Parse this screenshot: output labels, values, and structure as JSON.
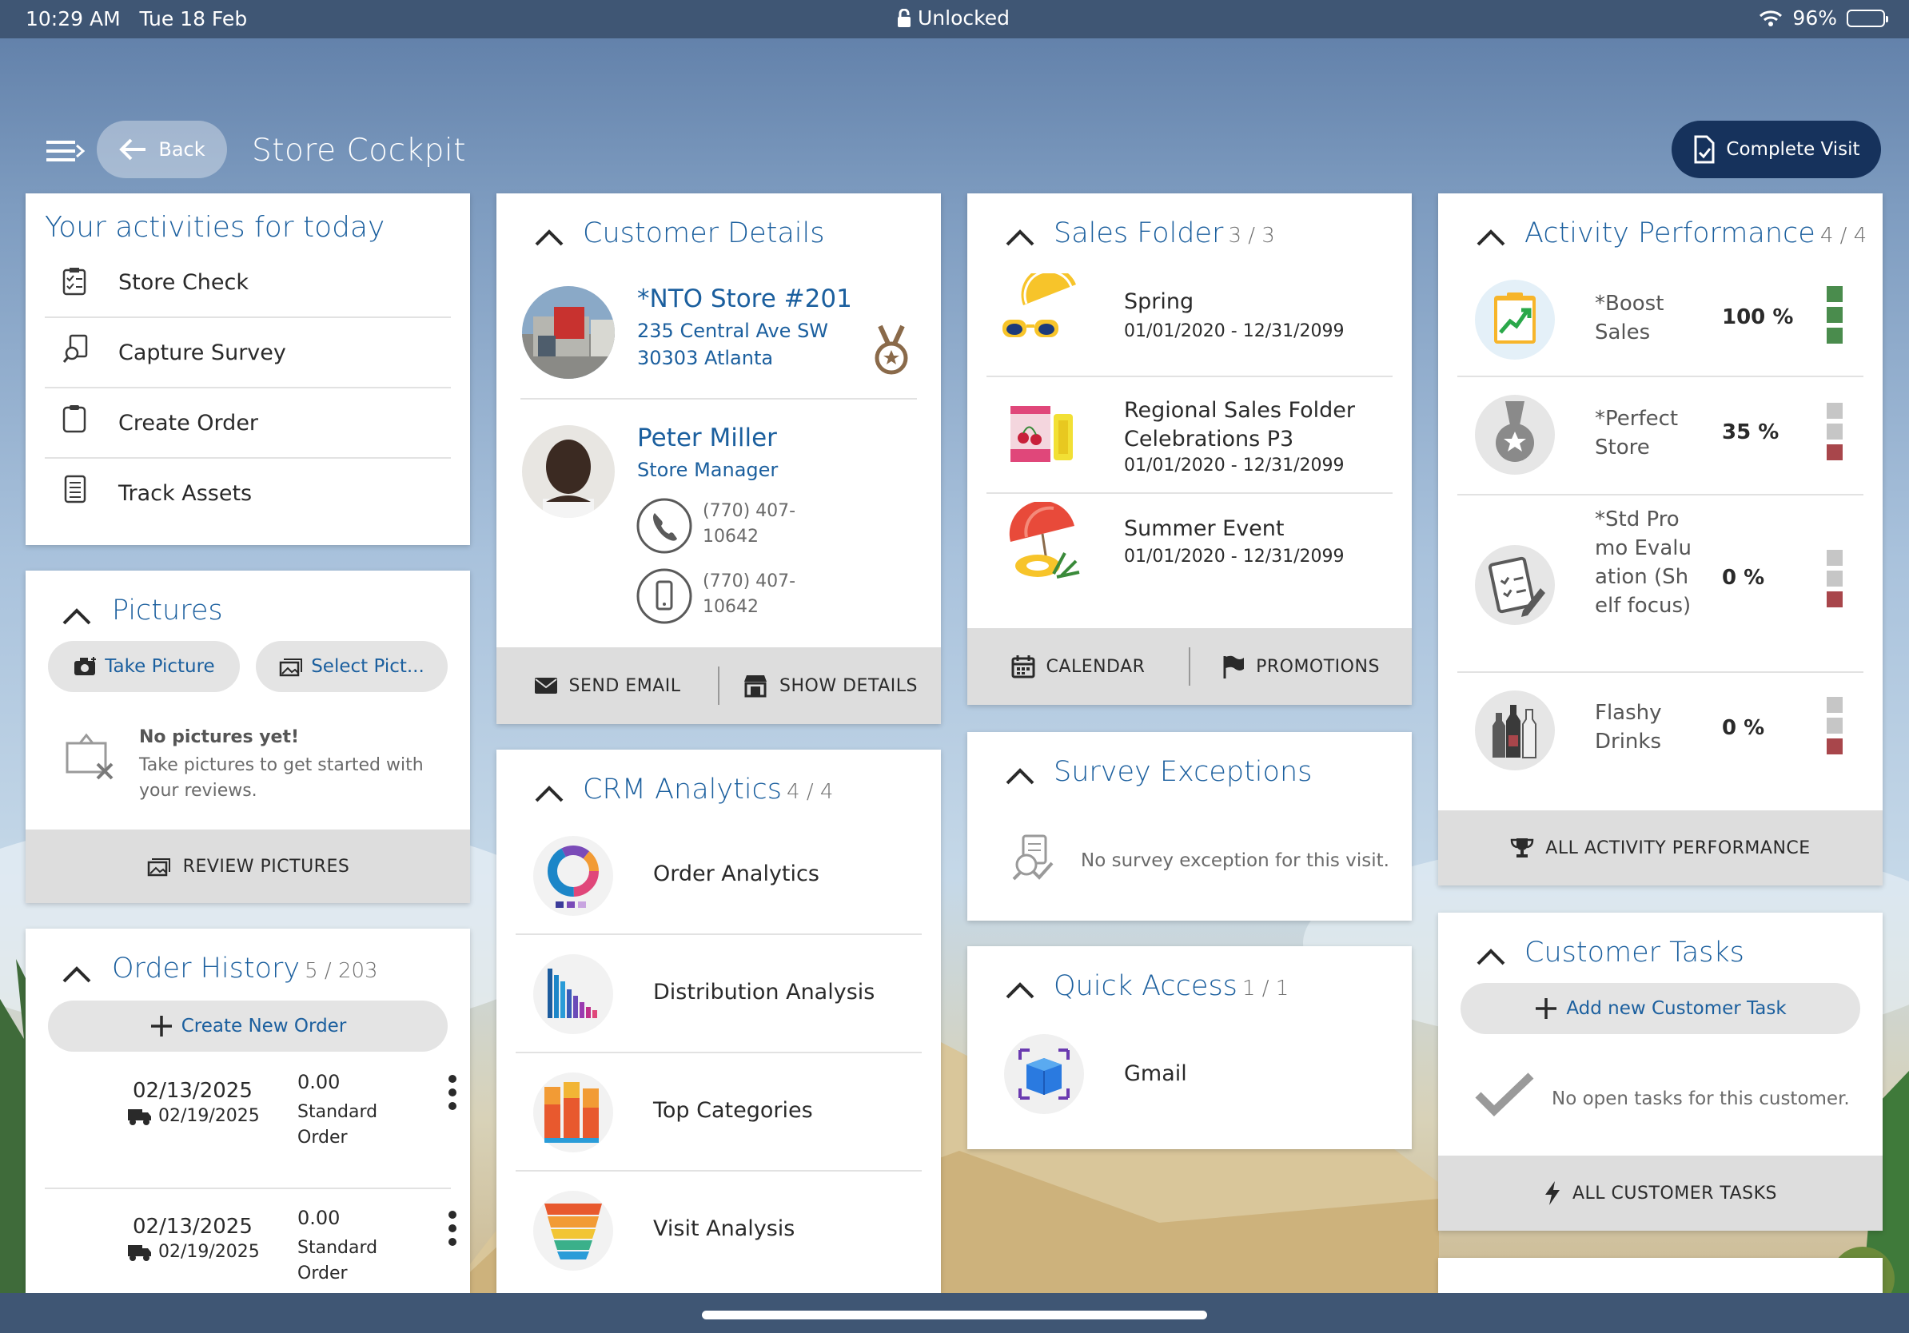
{
  "status_bar": {
    "time": "10:29 AM",
    "date": "Tue 18 Feb",
    "lock": "Unlocked",
    "battery": "96%"
  },
  "header": {
    "back_label": "Back",
    "title": "Store Cockpit",
    "complete_visit_label": "Complete Visit"
  },
  "activities": {
    "title": "Your activities for today",
    "items": [
      {
        "label": "Store Check",
        "icon": "checklist-icon"
      },
      {
        "label": "Capture Survey",
        "icon": "survey-search-icon"
      },
      {
        "label": "Create Order",
        "icon": "clipboard-icon"
      },
      {
        "label": "Track Assets",
        "icon": "asset-list-icon"
      }
    ]
  },
  "pictures": {
    "title": "Pictures",
    "take_label": "Take Picture",
    "select_label": "Select Pict...",
    "empty_title": "No pictures yet!",
    "empty_text": "Take pictures to get started with your reviews.",
    "review_label": "REVIEW PICTURES"
  },
  "order_history": {
    "title": "Order History",
    "count": "5 / 203",
    "create_label": "Create New Order",
    "orders": [
      {
        "order_date": "02/13/2025",
        "delivery_date": "02/19/2025",
        "amount": "0.00",
        "type": "Standard Order"
      },
      {
        "order_date": "02/13/2025",
        "delivery_date": "02/19/2025",
        "amount": "0.00",
        "type": "Standard Order"
      }
    ]
  },
  "customer_details": {
    "title": "Customer Details",
    "store_name": "*NTO Store #201",
    "address1": "235 Central Ave SW",
    "address2": "30303 Atlanta",
    "contact_name": "Peter Miller",
    "contact_role": "Store Manager",
    "phone": "(770) 407-10642",
    "mobile": "(770) 407-10642",
    "send_email_label": "SEND EMAIL",
    "show_details_label": "SHOW DETAILS"
  },
  "crm_analytics": {
    "title": "CRM Analytics",
    "count": "4 / 4",
    "items": [
      {
        "label": "Order Analytics",
        "icon": "donut-chart-icon"
      },
      {
        "label": "Distribution Analysis",
        "icon": "bar-chart-icon"
      },
      {
        "label": "Top Categories",
        "icon": "stacked-bar-icon"
      },
      {
        "label": "Visit Analysis",
        "icon": "funnel-chart-icon"
      }
    ]
  },
  "sales_folder": {
    "title": "Sales Folder",
    "count": "3 / 3",
    "items": [
      {
        "name": "Spring",
        "dates": "01/01/2020 - 12/31/2099",
        "icon": "sunglasses-lemon-icon"
      },
      {
        "name": "Regional Sales Folder Celebrations P3",
        "dates": "01/01/2020 - 12/31/2099",
        "icon": "cherry-drinks-icon"
      },
      {
        "name": "Summer Event",
        "dates": "01/01/2020 - 12/31/2099",
        "icon": "beach-umbrella-icon"
      }
    ],
    "calendar_label": "CALENDAR",
    "promotions_label": "PROMOTIONS"
  },
  "survey_exceptions": {
    "title": "Survey Exceptions",
    "empty_text": "No survey exception for this visit."
  },
  "quick_access": {
    "title": "Quick Access",
    "count": "1 / 1",
    "items": [
      {
        "label": "Gmail",
        "icon": "gmail-box-icon"
      }
    ]
  },
  "activity_performance": {
    "title": "Activity Performance",
    "count": "4 / 4",
    "items": [
      {
        "name": "*Boost Sales",
        "percent": "100 %",
        "icon": "growth-chart-icon",
        "levels": [
          "#4a8c4d",
          "#4a8c4d",
          "#4a8c4d"
        ]
      },
      {
        "name": "*Perfect Store",
        "percent": "35 %",
        "icon": "medal-icon",
        "levels": [
          "#c6c6c6",
          "#c6c6c6",
          "#a8464b"
        ]
      },
      {
        "name": "*Std Promo Evaluation (Shelf focus)",
        "percent": "0 %",
        "icon": "clipboard-pen-icon",
        "levels": [
          "#c6c6c6",
          "#c6c6c6",
          "#a8464b"
        ]
      },
      {
        "name": "Flashy Drinks",
        "percent": "0 %",
        "icon": "bottles-icon",
        "levels": [
          "#c6c6c6",
          "#c6c6c6",
          "#a8464b"
        ]
      }
    ],
    "all_label": "ALL ACTIVITY PERFORMANCE"
  },
  "customer_tasks": {
    "title": "Customer Tasks",
    "add_label": "Add new Customer Task",
    "empty_text": "No open tasks for this customer.",
    "all_label": "ALL CUSTOMER TASKS"
  }
}
